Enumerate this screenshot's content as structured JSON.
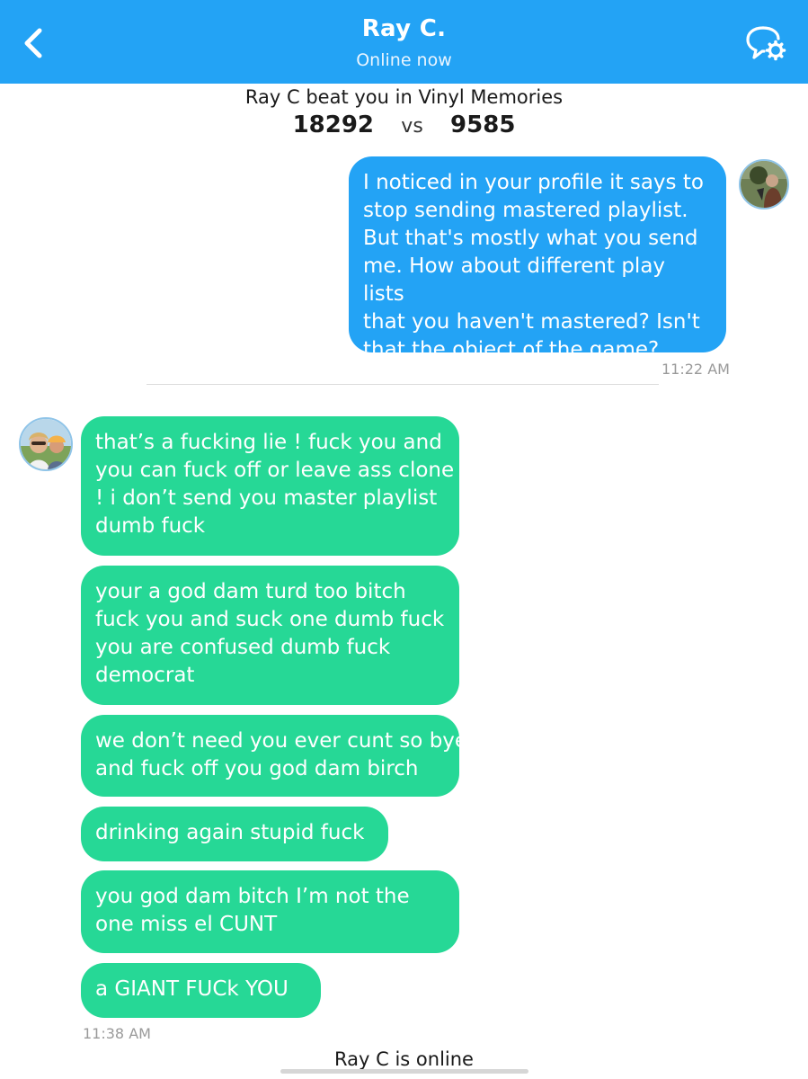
{
  "header": {
    "title": "Ray C.",
    "status": "Online now",
    "bg_color": "#23a3f5"
  },
  "game_result": {
    "text": "Ray C beat you in Vinyl Memories",
    "opponent_score": "18292",
    "vs": "vs",
    "my_score": "9585"
  },
  "messages": {
    "outgoing": {
      "text": "I noticed in your profile it says to\nstop sending mastered playlist.\nBut that's mostly what you send\nme. How about different play lists\nthat you haven't mastered? Isn't\nthat the object of the game?",
      "time": "11:22 AM"
    },
    "incoming": [
      {
        "text": "that’s a fucking lie ! fuck you and\nyou can fuck off or leave ass clone\n! i don’t send you master playlist\ndumb fuck"
      },
      {
        "text": "your a god dam turd too bitch\nfuck you and suck one dumb fuck\nyou are confused dumb fuck\ndemocrat"
      },
      {
        "text": "we don’t need you ever cunt so bye\nand fuck off you god dam birch"
      },
      {
        "text": "drinking again stupid fuck"
      },
      {
        "text": "you god dam bitch I’m not the\none miss el CUNT"
      },
      {
        "text": "a GIANT FUCk YOU"
      }
    ],
    "incoming_time": "11:38 AM"
  },
  "footer": {
    "online_text": "Ray C is online"
  },
  "colors": {
    "outgoing_bubble": "#23a3f5",
    "incoming_bubble": "#26d896"
  },
  "icons": {
    "back": "chevron-left-icon",
    "settings": "chat-settings-icon"
  }
}
